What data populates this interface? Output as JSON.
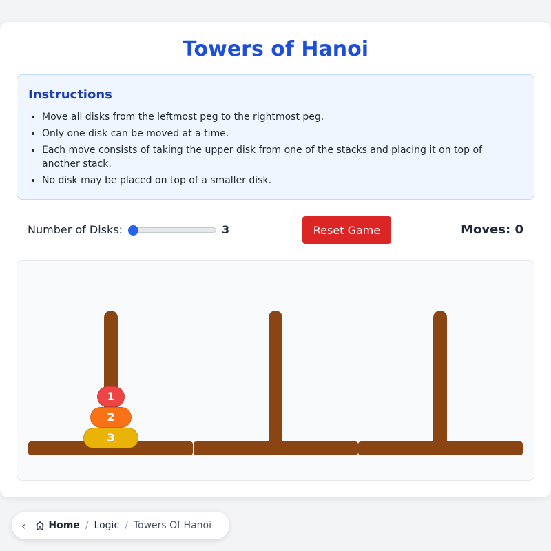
{
  "title": "Towers of Hanoi",
  "instructions": {
    "heading": "Instructions",
    "items": [
      "Move all disks from the leftmost peg to the rightmost peg.",
      "Only one disk can be moved at a time.",
      "Each move consists of taking the upper disk from one of the stacks and placing it on top of another stack.",
      "No disk may be placed on top of a smaller disk."
    ]
  },
  "controls": {
    "disk_label": "Number of Disks:",
    "disk_count": "3",
    "slider_min": 3,
    "slider_max": 8,
    "reset_label": "Reset Game",
    "moves_label": "Moves: 0"
  },
  "board": {
    "pegs": [
      {
        "disks": [
          {
            "label": "1",
            "color": "#ef4444"
          },
          {
            "label": "2",
            "color": "#f97316"
          },
          {
            "label": "3",
            "color": "#eab308"
          }
        ]
      },
      {
        "disks": []
      },
      {
        "disks": []
      }
    ],
    "wood_color": "#8b4513"
  },
  "breadcrumb": {
    "back_icon": "chevron-left-icon",
    "home": "Home",
    "separator": "/",
    "section": "Logic",
    "current": "Towers Of Hanoi"
  },
  "colors": {
    "accent": "#1d4ed8",
    "danger": "#dc2626",
    "slider": "#2563eb"
  }
}
